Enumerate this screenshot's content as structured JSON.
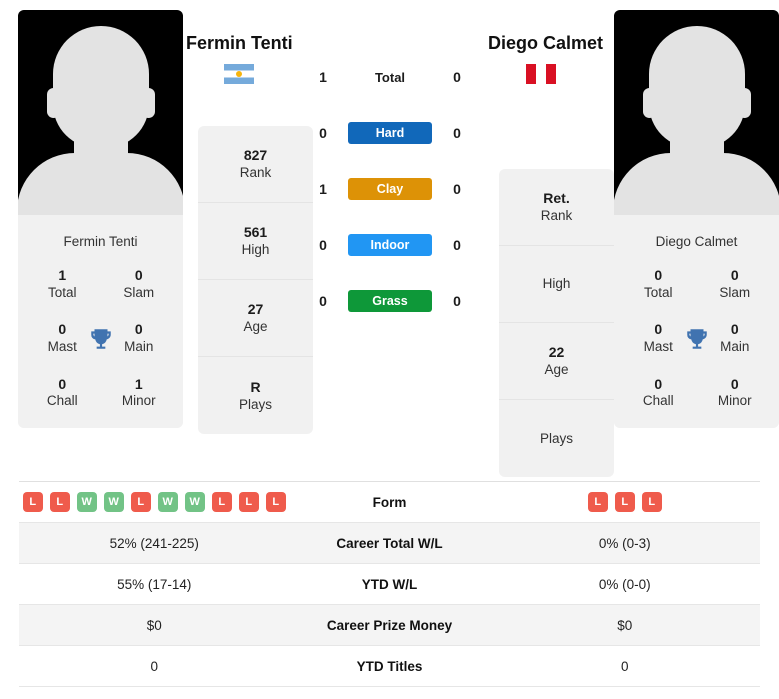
{
  "players": {
    "left": {
      "name": "Fermin Tenti",
      "flag": "argentina-flag",
      "avatar": "player-photo-placeholder",
      "titles": [
        {
          "num": "1",
          "label": "Total"
        },
        {
          "num": "0",
          "label": "Slam"
        },
        {
          "num": "0",
          "label": "Mast"
        },
        {
          "num": "0",
          "label": "Main"
        },
        {
          "num": "0",
          "label": "Chall"
        },
        {
          "num": "1",
          "label": "Minor"
        }
      ],
      "stats": [
        {
          "value": "827",
          "label": "Rank"
        },
        {
          "value": "561",
          "label": "High"
        },
        {
          "value": "27",
          "label": "Age"
        },
        {
          "value": "R",
          "label": "Plays"
        }
      ]
    },
    "right": {
      "name": "Diego Calmet",
      "flag": "peru-flag",
      "avatar": "player-photo-placeholder",
      "titles": [
        {
          "num": "0",
          "label": "Total"
        },
        {
          "num": "0",
          "label": "Slam"
        },
        {
          "num": "0",
          "label": "Mast"
        },
        {
          "num": "0",
          "label": "Main"
        },
        {
          "num": "0",
          "label": "Chall"
        },
        {
          "num": "0",
          "label": "Minor"
        }
      ],
      "stats": [
        {
          "value": "Ret.",
          "label": "Rank"
        },
        {
          "value": "",
          "label": "High"
        },
        {
          "value": "22",
          "label": "Age"
        },
        {
          "value": "",
          "label": "Plays"
        }
      ]
    }
  },
  "h2h": {
    "rows": [
      {
        "label": "Total",
        "left": "1",
        "right": "0",
        "style": "plain",
        "color": ""
      },
      {
        "label": "Hard",
        "left": "0",
        "right": "0",
        "style": "bar",
        "color": "#1168ba"
      },
      {
        "label": "Clay",
        "left": "1",
        "right": "0",
        "style": "bar",
        "color": "#dd9206"
      },
      {
        "label": "Indoor",
        "left": "0",
        "right": "0",
        "style": "bar",
        "color": "#2196f3"
      },
      {
        "label": "Grass",
        "left": "0",
        "right": "0",
        "style": "bar",
        "color": "#0e9839"
      }
    ]
  },
  "table": {
    "rows": [
      {
        "label": "Form",
        "type": "form",
        "shaded": false,
        "left_form": [
          "L",
          "L",
          "W",
          "W",
          "L",
          "W",
          "W",
          "L",
          "L",
          "L"
        ],
        "right_form": [
          "L",
          "L",
          "L"
        ],
        "left": "",
        "right": ""
      },
      {
        "label": "Career Total W/L",
        "type": "text",
        "shaded": true,
        "left": "52% (241-225)",
        "right": "0% (0-3)"
      },
      {
        "label": "YTD W/L",
        "type": "text",
        "shaded": false,
        "left": "55% (17-14)",
        "right": "0% (0-0)"
      },
      {
        "label": "Career Prize Money",
        "type": "text",
        "shaded": true,
        "left": "$0",
        "right": "$0"
      },
      {
        "label": "YTD Titles",
        "type": "text",
        "shaded": false,
        "left": "0",
        "right": "0"
      }
    ]
  },
  "colors": {
    "hard": "#1168ba",
    "clay": "#dd9206",
    "indoor": "#2196f3",
    "grass": "#0e9839",
    "win_badge": "#72c386",
    "loss_badge": "#ef5b4c",
    "trophy": "#4073b0"
  }
}
